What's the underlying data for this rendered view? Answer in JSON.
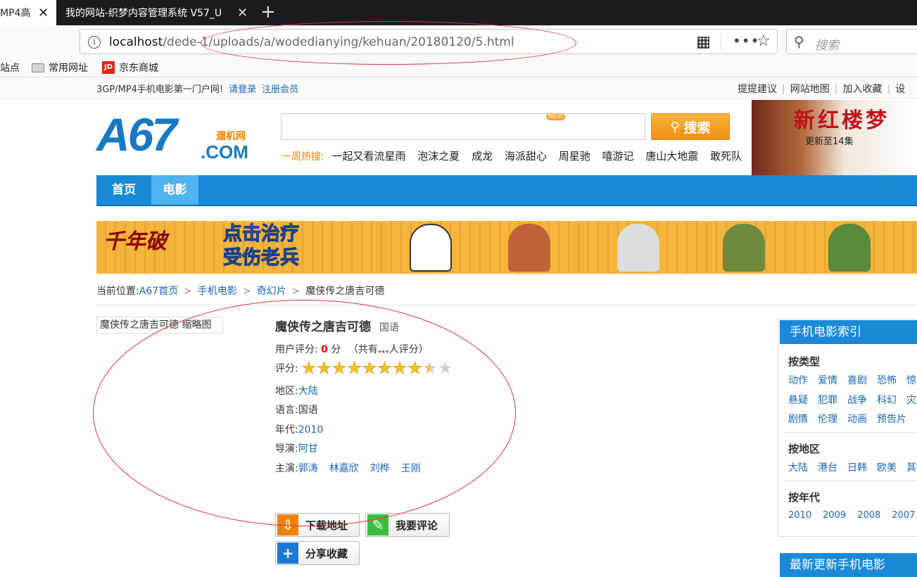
{
  "browser": {
    "tabs": [
      {
        "title": "MP4高",
        "active": true
      },
      {
        "title": "我的网站-织梦内容管理系统 V57_U",
        "active": false
      }
    ],
    "url_host": "localhost",
    "url_path": "/dede-1/uploads/a/wodedianying/kehuan/20180120/5.html",
    "search_placeholder": "搜索",
    "bookmarks": [
      {
        "label": "站点",
        "icon": "none"
      },
      {
        "label": "常用网址",
        "icon": "folder-icon"
      },
      {
        "label": "京东商城",
        "icon": "jd-icon"
      }
    ],
    "jd_logo": "JD"
  },
  "topbar": {
    "slogan": "3GP/MP4手机电影第一门户网!",
    "login": "请登录",
    "register": "注册会员",
    "links": [
      "提提建议",
      "网站地图",
      "加入收藏",
      "设"
    ]
  },
  "logo": {
    "main": "A67",
    "cn": "遛机网",
    "com": ".COM"
  },
  "search": {
    "new_badge": "NEW",
    "button": "搜索",
    "hot_label": "一周热搜:",
    "hot_keywords": [
      "一起又看流星雨",
      "泡沫之夏",
      "成龙",
      "海派甜心",
      "周星驰",
      "嘻游记",
      "唐山大地震",
      "敢死队"
    ]
  },
  "ad_right": {
    "title": "新红楼梦",
    "subtitle": "更新至14集"
  },
  "menu": {
    "home": "首页",
    "movie": "电影"
  },
  "banner": {
    "left": "千年破",
    "line1": "点击治疗",
    "line2": "受伤老兵"
  },
  "breadcrumb": {
    "label": "当前位置:",
    "items": [
      "A67首页",
      "手机电影",
      "奇幻片",
      "魔侠传之唐吉可德"
    ]
  },
  "thumb_label": "魔侠传之唐吉可德 缩略图",
  "movie": {
    "title": "魔侠传之唐吉可德",
    "lang_tag": "国语",
    "user_score_label": "用户评分:",
    "user_score": "0",
    "user_score_unit": "分",
    "votes_prefix": "（共有",
    "votes": "...",
    "votes_suffix": "人评分）",
    "rating_label": "评分:",
    "rating_stars": 8.5,
    "rating_max": 10,
    "region_label": "地区:",
    "region": "大陆",
    "language_label": "语言:",
    "language": "国语",
    "year_label": "年代:",
    "year": "2010",
    "director_label": "导演:",
    "director": "阿甘",
    "cast_label": "主演:",
    "cast": [
      "郭涛",
      "林嘉欣",
      "刘桦",
      "王刚"
    ]
  },
  "buttons": {
    "download": "下载地址",
    "comment": "我要评论",
    "share": "分享收藏"
  },
  "sidebar": {
    "title": "手机电影索引",
    "by_type": "按类型",
    "types_row1": [
      "动作",
      "爱情",
      "喜剧",
      "恐怖",
      "惊"
    ],
    "types_row2": [
      "悬疑",
      "犯罪",
      "战争",
      "科幻",
      "灾"
    ],
    "types_row3": [
      "剧情",
      "伦理",
      "动画",
      "预告片"
    ],
    "by_region": "按地区",
    "regions": [
      "大陆",
      "港台",
      "日韩",
      "欧美",
      "其"
    ],
    "by_year": "按年代",
    "years": [
      "2010",
      "2009",
      "2008",
      "2007"
    ],
    "latest_title": "最新更新手机电影"
  },
  "colors": {
    "accent_blue": "#1a8ad8",
    "link_blue": "#1a66b3",
    "orange": "#f08300",
    "annotation_red": "#dd3333"
  }
}
